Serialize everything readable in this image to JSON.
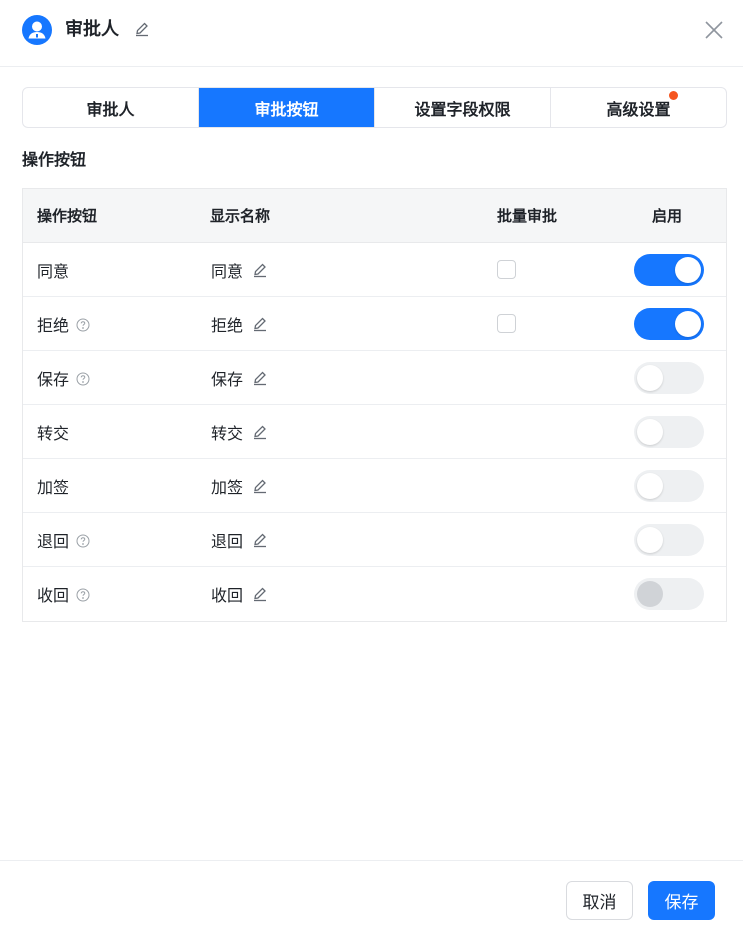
{
  "header": {
    "title": "审批人",
    "avatar_icon": "user-avatar-icon",
    "edit_icon": "pencil-icon",
    "close_icon": "close-icon"
  },
  "tabs": [
    {
      "label": "审批人",
      "active": false
    },
    {
      "label": "审批按钮",
      "active": true
    },
    {
      "label": "设置字段权限",
      "active": false
    },
    {
      "label": "高级设置",
      "active": false,
      "has_dot": true
    }
  ],
  "section_title": "操作按钮",
  "table": {
    "headers": {
      "action": "操作按钮",
      "display_name": "显示名称",
      "batch": "批量审批",
      "enabled": "启用"
    },
    "rows": [
      {
        "action": "同意",
        "display_name": "同意",
        "help": false,
        "batch_checkbox": true,
        "batch_checked": false,
        "enabled": true,
        "disabled": false
      },
      {
        "action": "拒绝",
        "display_name": "拒绝",
        "help": true,
        "batch_checkbox": true,
        "batch_checked": false,
        "enabled": true,
        "disabled": false
      },
      {
        "action": "保存",
        "display_name": "保存",
        "help": true,
        "batch_checkbox": false,
        "enabled": false,
        "disabled": false
      },
      {
        "action": "转交",
        "display_name": "转交",
        "help": false,
        "batch_checkbox": false,
        "enabled": false,
        "disabled": false
      },
      {
        "action": "加签",
        "display_name": "加签",
        "help": false,
        "batch_checkbox": false,
        "enabled": false,
        "disabled": false
      },
      {
        "action": "退回",
        "display_name": "退回",
        "help": true,
        "batch_checkbox": false,
        "enabled": false,
        "disabled": false
      },
      {
        "action": "收回",
        "display_name": "收回",
        "help": true,
        "batch_checkbox": false,
        "enabled": false,
        "disabled": true
      }
    ]
  },
  "footer": {
    "cancel_label": "取消",
    "save_label": "保存"
  },
  "colors": {
    "accent": "#1677ff",
    "notification_dot": "#f5551f"
  }
}
